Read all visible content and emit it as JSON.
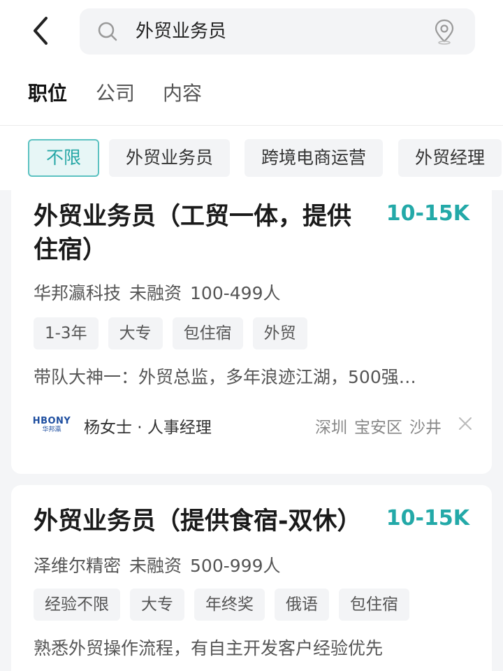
{
  "search": {
    "query": "外贸业务员"
  },
  "tabs": [
    {
      "label": "职位",
      "active": true
    },
    {
      "label": "公司",
      "active": false
    },
    {
      "label": "内容",
      "active": false
    }
  ],
  "chips": [
    {
      "label": "不限",
      "active": true
    },
    {
      "label": "外贸业务员",
      "active": false
    },
    {
      "label": "跨境电商运营",
      "active": false
    },
    {
      "label": "外贸经理",
      "active": false
    }
  ],
  "jobs": [
    {
      "title_line1": "外贸业务员（工贸一体，提供",
      "title_line2": "住宿）",
      "salary": "10-15K",
      "company": "华邦瀛科技",
      "funding": "未融资",
      "size": "100-499人",
      "tags": [
        "1-3年",
        "大专",
        "包住宿",
        "外贸"
      ],
      "desc": "带队大神一：外贸总监，多年浪迹江湖，500强…",
      "logo_text": "HBONY",
      "logo_sub": "华邦瀛",
      "recruiter": "杨女士 · 人事经理",
      "city": "深圳",
      "district": "宝安区",
      "area": "沙井"
    },
    {
      "title": "外贸业务员（提供食宿-双休）",
      "salary": "10-15K",
      "company": "泽维尔精密",
      "funding": "未融资",
      "size": "500-999人",
      "tags": [
        "经验不限",
        "大专",
        "年终奖",
        "俄语",
        "包住宿"
      ],
      "desc": "熟悉外贸操作流程，有自主开发客户经验优先"
    }
  ],
  "colors": {
    "accent": "#23a9a8",
    "chip_active_bg": "#e7f6f6",
    "page_bg": "#f4f5f7"
  }
}
